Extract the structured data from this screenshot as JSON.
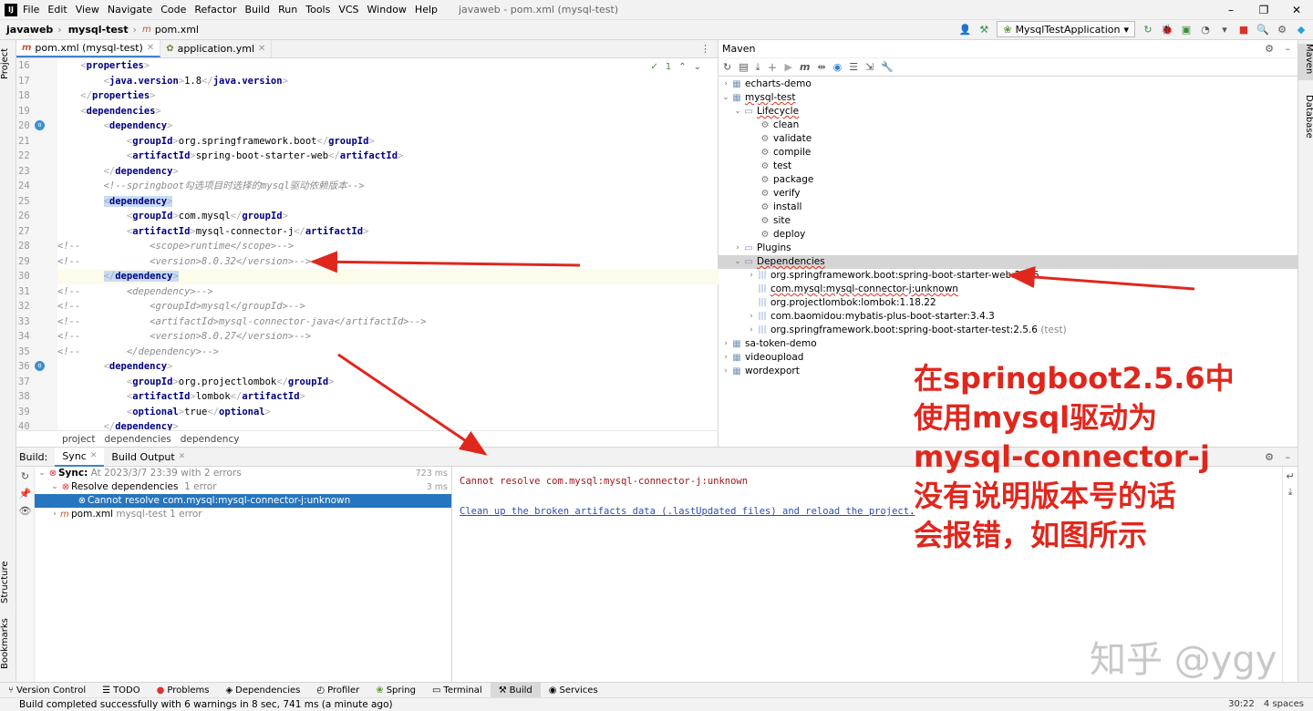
{
  "menubar": {
    "items": [
      "File",
      "Edit",
      "View",
      "Navigate",
      "Code",
      "Refactor",
      "Build",
      "Run",
      "Tools",
      "VCS",
      "Window",
      "Help"
    ],
    "window_title": "javaweb - pom.xml (mysql-test)"
  },
  "navbar": {
    "project": "javaweb",
    "module": "mysql-test",
    "file": "pom.xml",
    "run_config": "MysqlTestApplication"
  },
  "editor": {
    "tabs": [
      {
        "label": "pom.xml (mysql-test)",
        "active": true
      },
      {
        "label": "application.yml",
        "active": false
      }
    ],
    "inspection": "1",
    "lines": [
      "16",
      "17",
      "18",
      "19",
      "20",
      "21",
      "22",
      "23",
      "24",
      "25",
      "26",
      "27",
      "28",
      "29",
      "30",
      "31",
      "32",
      "33",
      "34",
      "35",
      "36",
      "37",
      "38",
      "39",
      "40"
    ],
    "breadcrumb": [
      "project",
      "dependencies",
      "dependency"
    ]
  },
  "maven": {
    "title": "Maven",
    "tree": [
      {
        "label": "echarts-demo"
      },
      {
        "label": "mysql-test"
      },
      {
        "label": "Lifecycle"
      },
      {
        "label": "clean"
      },
      {
        "label": "validate"
      },
      {
        "label": "compile"
      },
      {
        "label": "test"
      },
      {
        "label": "package"
      },
      {
        "label": "verify"
      },
      {
        "label": "install"
      },
      {
        "label": "site"
      },
      {
        "label": "deploy"
      },
      {
        "label": "Plugins"
      },
      {
        "label": "Dependencies"
      },
      {
        "label": "org.springframework.boot:spring-boot-starter-web:2.5.6"
      },
      {
        "label": "com.mysql:mysql-connector-j:unknown"
      },
      {
        "label": "org.projectlombok:lombok:1.18.22"
      },
      {
        "label": "com.baomidou:mybatis-plus-boot-starter:3.4.3"
      },
      {
        "label": "org.springframework.boot:spring-boot-starter-test:2.5.6",
        "suffix": "(test)"
      },
      {
        "label": "sa-token-demo"
      },
      {
        "label": "videoupload"
      },
      {
        "label": "wordexport"
      }
    ]
  },
  "build": {
    "label": "Build:",
    "tabs": [
      "Sync",
      "Build Output"
    ],
    "sync_title": "Sync:",
    "sync_detail": "At 2023/3/7 23:39 with 2 errors",
    "sync_time": "723 ms",
    "resolve": "Resolve dependencies",
    "resolve_err": "1 error",
    "resolve_time": "3 ms",
    "error_item": "Cannot resolve com.mysql:mysql-connector-j:unknown",
    "pom": "pom.xml",
    "pom_detail": "mysql-test 1 error",
    "output_msg": "Cannot resolve com.mysql:mysql-connector-j:unknown",
    "output_link": "Clean up the broken artifacts data (.lastUpdated files) and reload the project"
  },
  "sidebars": {
    "left": [
      "Project",
      "Structure",
      "Bookmarks"
    ],
    "right": [
      "Maven",
      "Database"
    ]
  },
  "bottom_tools": [
    "Version Control",
    "TODO",
    "Problems",
    "Dependencies",
    "Profiler",
    "Spring",
    "Terminal",
    "Build",
    "Services"
  ],
  "status": {
    "message": "Build completed successfully with 6 warnings in 8 sec, 741 ms (a minute ago)",
    "position": "30:22",
    "indent": "4 spaces"
  },
  "annotation": "在springboot2.5.6中\n使用mysql驱动为\nmysql-connector-j\n没有说明版本号的话\n会报错，如图所示",
  "watermark": "知乎 @ygy",
  "colors": {
    "annotation": "#e0271d",
    "selection": "#2675bf",
    "tag": "#000080"
  }
}
